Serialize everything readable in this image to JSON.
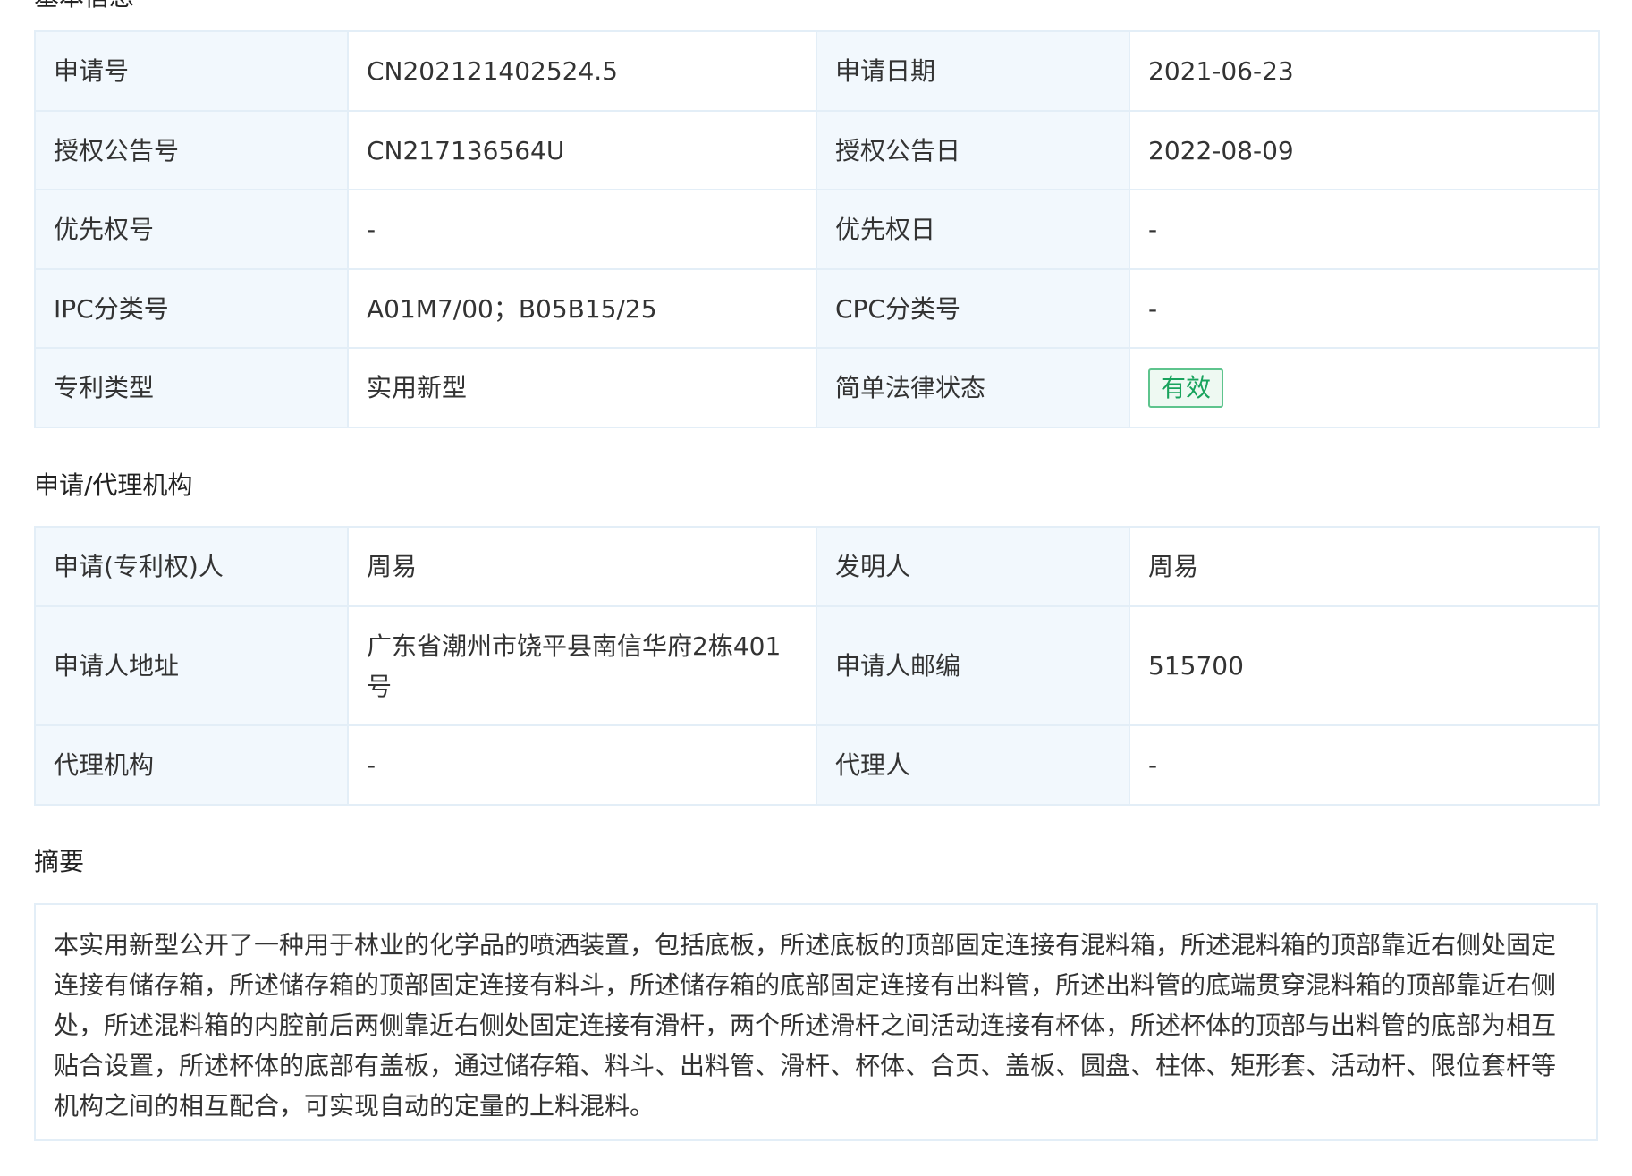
{
  "basic_info": {
    "heading": "基本信息",
    "rows": [
      {
        "label1": "申请号",
        "value1": "CN202121402524.5",
        "label2": "申请日期",
        "value2": "2021-06-23"
      },
      {
        "label1": "授权公告号",
        "value1": "CN217136564U",
        "label2": "授权公告日",
        "value2": "2022-08-09"
      },
      {
        "label1": "优先权号",
        "value1": "-",
        "label2": "优先权日",
        "value2": "-"
      },
      {
        "label1": "IPC分类号",
        "value1": "A01M7/00；B05B15/25",
        "label2": "CPC分类号",
        "value2": "-"
      },
      {
        "label1": "专利类型",
        "value1": "实用新型",
        "label2": "简单法律状态",
        "value2": "有效"
      }
    ],
    "status_color": "#19a35d"
  },
  "agency_info": {
    "heading": "申请/代理机构",
    "rows": [
      {
        "label1": "申请(专利权)人",
        "value1": "周易",
        "label2": "发明人",
        "value2": "周易"
      },
      {
        "label1": "申请人地址",
        "value1": "广东省潮州市饶平县南信华府2栋401号",
        "label2": "申请人邮编",
        "value2": "515700"
      },
      {
        "label1": "代理机构",
        "value1": "-",
        "label2": "代理人",
        "value2": "-"
      }
    ]
  },
  "abstract": {
    "heading": "摘要",
    "text": "本实用新型公开了一种用于林业的化学品的喷洒装置，包括底板，所述底板的顶部固定连接有混料箱，所述混料箱的顶部靠近右侧处固定连接有储存箱，所述储存箱的顶部固定连接有料斗，所述储存箱的底部固定连接有出料管，所述出料管的底端贯穿混料箱的顶部靠近右侧处，所述混料箱的内腔前后两侧靠近右侧处固定连接有滑杆，两个所述滑杆之间活动连接有杯体，所述杯体的顶部与出料管的底部为相互贴合设置，所述杯体的底部有盖板，通过储存箱、料斗、出料管、滑杆、杯体、合页、盖板、圆盘、柱体、矩形套、活动杆、限位套杆等机构之间的相互配合，可实现自动的定量的上料混料。"
  },
  "colors": {
    "label_bg": "#f2f8fd",
    "border": "#e3eef7",
    "badge_border": "#5ec48d"
  }
}
